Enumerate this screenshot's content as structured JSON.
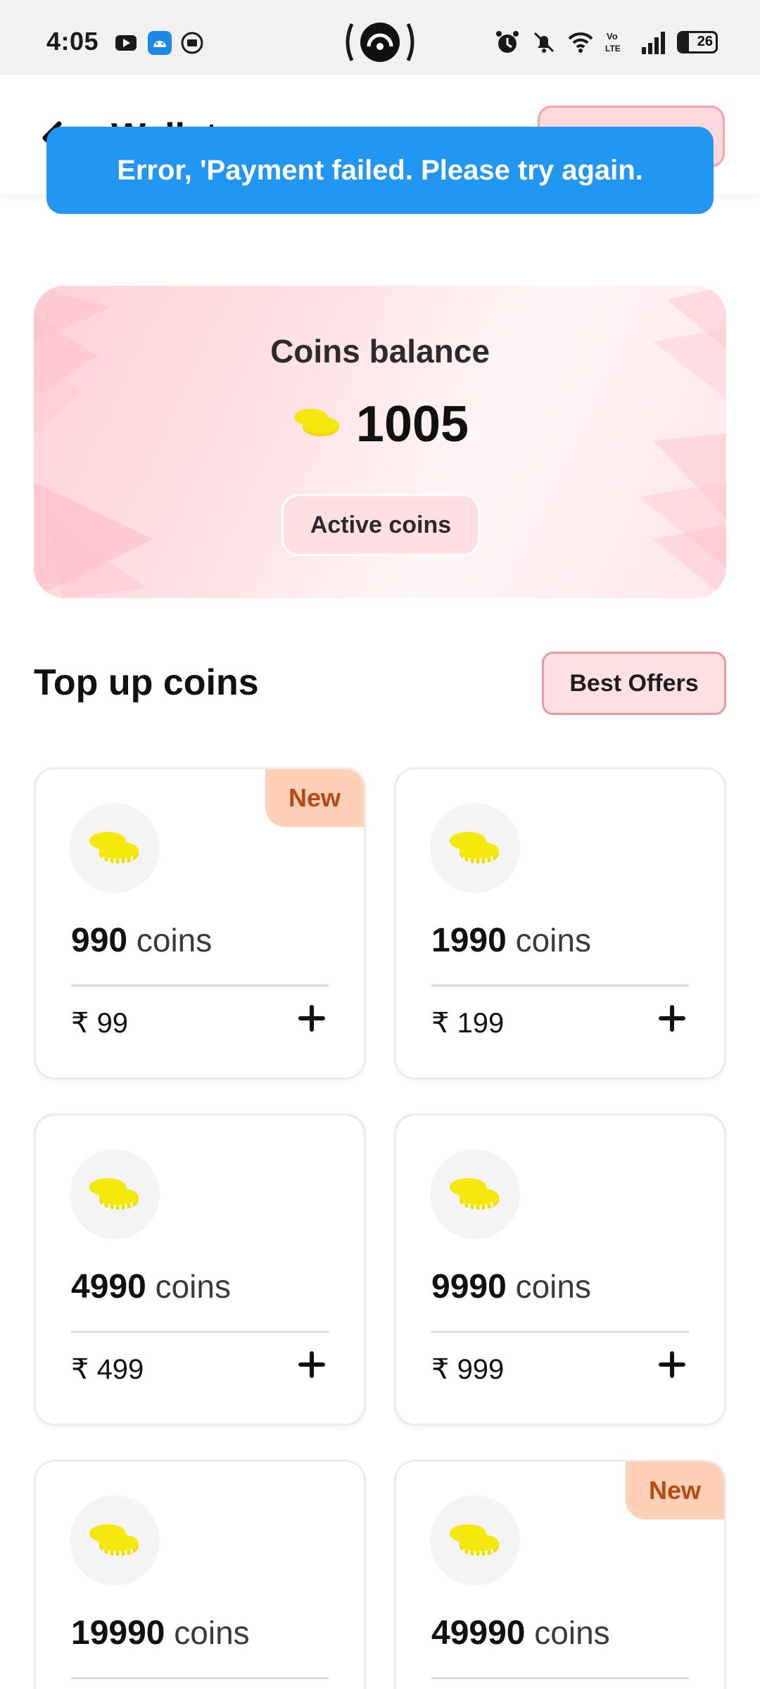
{
  "status_bar": {
    "time": "4:05",
    "battery": "26"
  },
  "header": {
    "title": "Wallet"
  },
  "toast": {
    "message": "Error, 'Payment failed. Please try again."
  },
  "balance": {
    "label": "Coins balance",
    "value": "1005",
    "pill": "Active coins"
  },
  "topup": {
    "title": "Top up coins",
    "offers_label": "Best Offers"
  },
  "packs": [
    {
      "coins": "990",
      "unit": "coins",
      "price": "₹ 99",
      "badge": "New"
    },
    {
      "coins": "1990",
      "unit": "coins",
      "price": "₹ 199",
      "badge": ""
    },
    {
      "coins": "4990",
      "unit": "coins",
      "price": "₹ 499",
      "badge": ""
    },
    {
      "coins": "9990",
      "unit": "coins",
      "price": "₹ 999",
      "badge": ""
    },
    {
      "coins": "19990",
      "unit": "coins",
      "price": "",
      "badge": ""
    },
    {
      "coins": "49990",
      "unit": "coins",
      "price": "",
      "badge": "New"
    }
  ],
  "colors": {
    "toast": "#2196f3",
    "coin": "#f5e80c",
    "badge_bg": "#ffcfb7",
    "badge_text": "#b64a12",
    "accent_pink": "#ffd9dc"
  },
  "icons": {
    "back": "arrow-left-icon",
    "coin": "coin-stack-icon",
    "add": "plus-icon"
  }
}
